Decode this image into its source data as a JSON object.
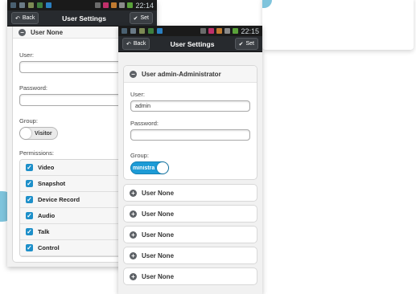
{
  "statusbar": {
    "phone1_time": "22:14",
    "phone2_time": "22:15"
  },
  "titlebar": {
    "back_label": "Back",
    "title": "User Settings",
    "set_label": "Set"
  },
  "phone1": {
    "user_header": "User None",
    "user_label": "User:",
    "user_value": "",
    "password_label": "Password:",
    "password_value": "",
    "group_label": "Group:",
    "group_value": "Visitor",
    "permissions_label": "Permissions:",
    "permissions": [
      {
        "label": "Video",
        "checked": true
      },
      {
        "label": "Snapshot",
        "checked": true
      },
      {
        "label": "Device Record",
        "checked": true
      },
      {
        "label": "Audio",
        "checked": true
      },
      {
        "label": "Talk",
        "checked": true
      },
      {
        "label": "Control",
        "checked": true
      }
    ]
  },
  "phone2": {
    "user_header": "User admin-Administrator",
    "user_label": "User:",
    "user_value": "admin",
    "password_label": "Password:",
    "password_value": "",
    "group_label": "Group:",
    "group_value": "ministra",
    "collapsed_users": [
      "User None",
      "User None",
      "User None",
      "User None",
      "User None"
    ]
  },
  "colors": {
    "accent": "#1d9bd6",
    "decor": "#7fc4dc",
    "titlebar": "#272a2e"
  }
}
